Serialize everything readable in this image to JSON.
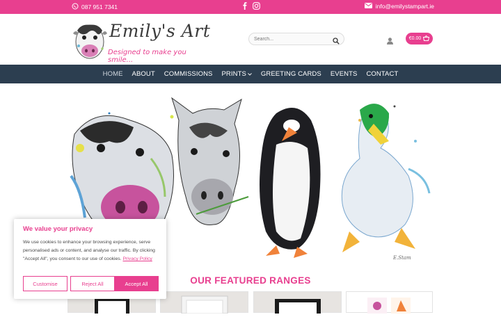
{
  "topbar": {
    "phone": "087 951 7341",
    "email": "info@emilystampart.ie"
  },
  "header": {
    "logo_title": "Emily's Art",
    "logo_tagline": "Designed to make you smile...",
    "search_placeholder": "Search...",
    "cart_amount": "€0.00"
  },
  "nav": {
    "items": [
      {
        "label": "HOME"
      },
      {
        "label": "ABOUT"
      },
      {
        "label": "COMMISSIONS"
      },
      {
        "label": "PRINTS"
      },
      {
        "label": "GREETING CARDS"
      },
      {
        "label": "EVENTS"
      },
      {
        "label": "CONTACT"
      }
    ]
  },
  "hero": {
    "signature": "E.Stam"
  },
  "featured": {
    "title": "OUR FEATURED RANGES"
  },
  "cookie": {
    "title": "We value your privacy",
    "body": "We use cookies to enhance your browsing experience, serve personalised ads or content, and analyse our traffic. By clicking \"Accept All\", you consent to our use of cookies.",
    "link": "Privacy Policy",
    "customise": "Customise",
    "reject": "Reject All",
    "accept": "Accept All"
  },
  "colors": {
    "brand_pink": "#e83f8f",
    "nav_bg": "#2c3e50"
  }
}
